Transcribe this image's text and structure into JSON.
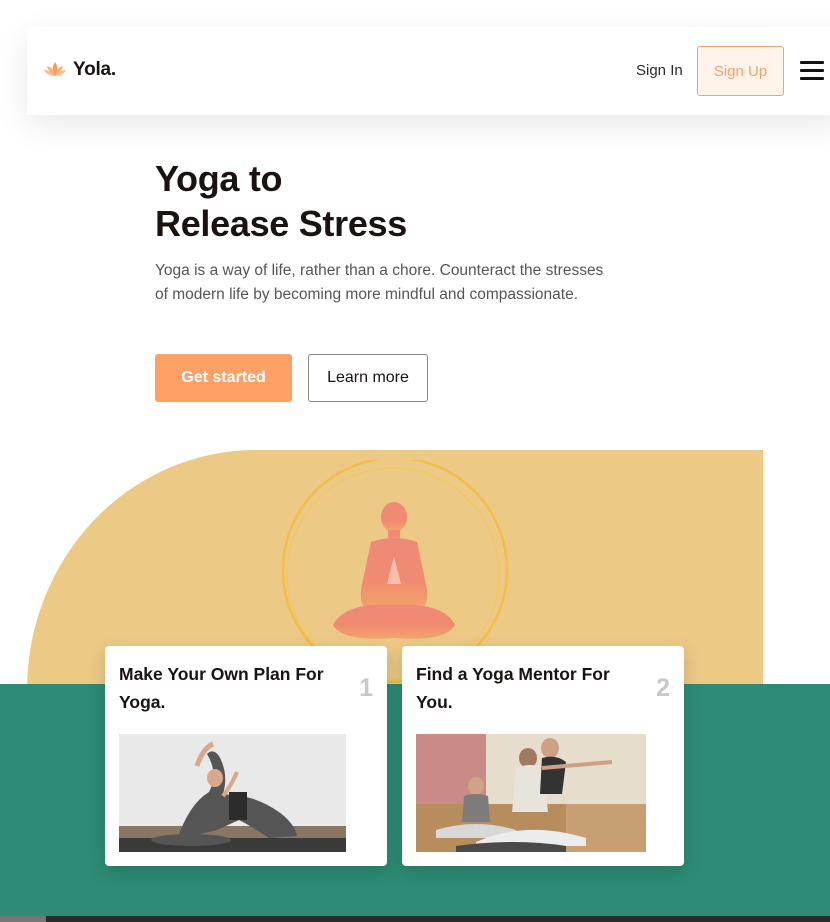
{
  "header": {
    "logo_text": "Yola.",
    "logo_icon": "lotus-icon",
    "signin_label": "Sign In",
    "signup_label": "Sign Up",
    "menu_icon": "hamburger-menu-icon"
  },
  "hero": {
    "title_line1": "Yoga to",
    "title_line2": "Release Stress",
    "description": "Yoga is a way of life, rather than a chore. Counteract the stresses of modern life by becoming more mindful and compassionate.",
    "primary_cta": "Get started",
    "secondary_cta": "Learn more",
    "illustration": "meditating-figure-illustration"
  },
  "cards": [
    {
      "title": "Make Your Own Plan For Yoga.",
      "number": "1",
      "image": "yoga-pose-photo"
    },
    {
      "title": "Find a Yoga Mentor For You.",
      "number": "2",
      "image": "yoga-class-photo"
    }
  ],
  "colors": {
    "accent": "#ffa066",
    "signup_border": "#f2a26b",
    "sun": "#ecca85",
    "green": "#2e8c74",
    "heading": "#1b1212"
  }
}
